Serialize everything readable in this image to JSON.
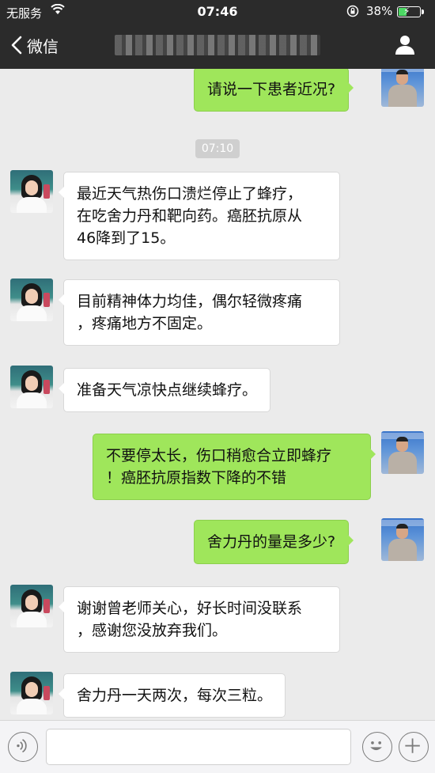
{
  "status_bar": {
    "carrier": "无服务",
    "time": "07:46",
    "battery_percent": "38%",
    "battery_level": 0.38,
    "charging": true
  },
  "nav": {
    "back_label": "微信",
    "title": "",
    "title_blurred": true
  },
  "messages": [
    {
      "side": "right",
      "sender": "doctor",
      "lines": [
        "请说一下患者近况?"
      ]
    },
    {
      "type": "timestamp",
      "text": "07:10"
    },
    {
      "side": "left",
      "sender": "patient",
      "lines": [
        "最近天气热伤口溃烂停止了蜂疗，",
        "在吃舍力丹和靶向药。癌胚抗原从",
        "46降到了15。"
      ]
    },
    {
      "side": "left",
      "sender": "patient",
      "lines": [
        "目前精神体力均佳，偶尔轻微疼痛",
        "，疼痛地方不固定。"
      ]
    },
    {
      "side": "left",
      "sender": "patient",
      "lines": [
        "准备天气凉快点继续蜂疗。"
      ]
    },
    {
      "side": "right",
      "sender": "doctor",
      "lines": [
        "不要停太长，伤口稍愈合立即蜂疗",
        "！癌胚抗原指数下降的不错"
      ]
    },
    {
      "side": "right",
      "sender": "doctor",
      "lines": [
        "舍力丹的量是多少?"
      ]
    },
    {
      "side": "left",
      "sender": "patient",
      "lines": [
        "谢谢曾老师关心，好长时间没联系",
        "，感谢您没放弃我们。"
      ]
    },
    {
      "side": "left",
      "sender": "patient",
      "lines": [
        "舍力丹一天两次，每次三粒。"
      ]
    }
  ],
  "input_bar": {
    "text_value": ""
  },
  "colors": {
    "header_bg": "#2b2b2b",
    "chat_bg": "#ebebeb",
    "sent_bubble": "#9fe65b",
    "received_bubble": "#ffffff",
    "battery": "#4cd964"
  },
  "icons": [
    "wifi-icon",
    "lock-rotation-icon",
    "battery-icon",
    "back-chevron-icon",
    "profile-icon",
    "voice-icon",
    "emoji-icon",
    "plus-icon"
  ]
}
